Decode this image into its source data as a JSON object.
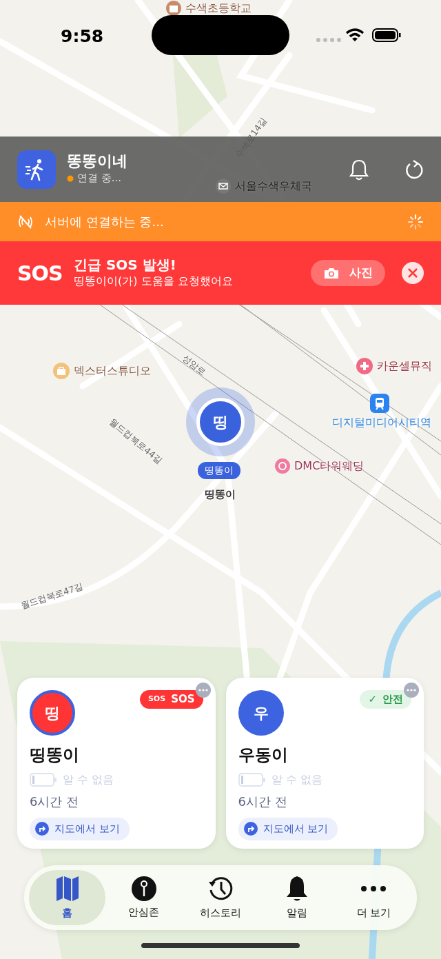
{
  "status_bar": {
    "time": "9:58"
  },
  "map": {
    "labels": [
      {
        "text": "수색초등학교",
        "kind": "school"
      },
      {
        "text": "수색로14길",
        "kind": "road"
      },
      {
        "text": "서울수색우체국",
        "kind": "post"
      },
      {
        "text": "덱스터스튜디오",
        "kind": "shop"
      },
      {
        "text": "성암로",
        "kind": "road"
      },
      {
        "text": "카운셀뮤직",
        "kind": "medical"
      },
      {
        "text": "디지털미디어시티역",
        "kind": "station"
      },
      {
        "text": "월드컵북로44길",
        "kind": "road"
      },
      {
        "text": "DMC타워웨딩",
        "kind": "wedding"
      },
      {
        "text": "월드컵북로47길",
        "kind": "road"
      }
    ],
    "marker": {
      "initial": "띵",
      "tag": "띵똥이",
      "name": "띵똥이"
    }
  },
  "header": {
    "title": "똥똥이네",
    "status": "연결 중..."
  },
  "connection_banner": {
    "text": "서버에 연결하는 중..."
  },
  "sos_banner": {
    "badge": "SOS",
    "title": "긴급 SOS 발생!",
    "message": "띵똥이이(가) 도움을 요청했어요",
    "photo_button": "사진"
  },
  "members": [
    {
      "initial": "띵",
      "name": "띵똥이",
      "kind": "sos",
      "badge_icon": "SOS",
      "badge_label": "SOS",
      "battery": "알 수 없음",
      "last_seen": "6시간 전",
      "map_button": "지도에서 보기"
    },
    {
      "initial": "우",
      "name": "우동이",
      "kind": "safe",
      "badge_icon": "✓",
      "badge_label": "안전",
      "battery": "알 수 없음",
      "last_seen": "6시간 전",
      "map_button": "지도에서 보기"
    }
  ],
  "tabs": [
    {
      "label": "홈",
      "selected": true
    },
    {
      "label": "안심존",
      "selected": false
    },
    {
      "label": "히스토리",
      "selected": false
    },
    {
      "label": "알림",
      "selected": false
    },
    {
      "label": "더 보기",
      "selected": false
    }
  ]
}
